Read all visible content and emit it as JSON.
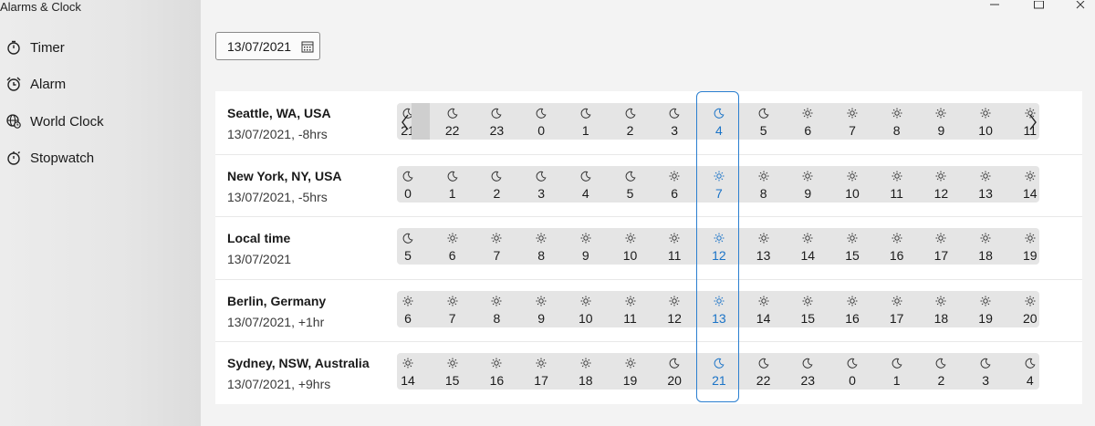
{
  "app": {
    "title": "Alarms & Clock"
  },
  "nav": [
    {
      "label": "Timer",
      "icon": "timer-icon"
    },
    {
      "label": "Alarm",
      "icon": "alarm-icon"
    },
    {
      "label": "World Clock",
      "icon": "globe-icon"
    },
    {
      "label": "Stopwatch",
      "icon": "stopwatch-icon"
    }
  ],
  "window": {
    "buttons": [
      "minimize-icon",
      "maximize-icon",
      "close-icon"
    ]
  },
  "date_picker": {
    "value": "13/07/2021",
    "icon": "calendar-icon"
  },
  "colors": {
    "accent": "#2b7fd0",
    "strip": "#e5e5e5",
    "card": "#ffffff"
  },
  "rows": [
    {
      "city": "Seattle, WA, USA",
      "sub": "13/07/2021, -8hrs",
      "scrollable": true,
      "hours": [
        {
          "h": "21",
          "icon": "moon"
        },
        {
          "h": "22",
          "icon": "moon"
        },
        {
          "h": "23",
          "icon": "moon"
        },
        {
          "h": "0",
          "icon": "moon"
        },
        {
          "h": "1",
          "icon": "moon"
        },
        {
          "h": "2",
          "icon": "moon"
        },
        {
          "h": "3",
          "icon": "moon"
        },
        {
          "h": "4",
          "icon": "moon",
          "current": true
        },
        {
          "h": "5",
          "icon": "moon"
        },
        {
          "h": "6",
          "icon": "sun"
        },
        {
          "h": "7",
          "icon": "sun"
        },
        {
          "h": "8",
          "icon": "sun"
        },
        {
          "h": "9",
          "icon": "sun"
        },
        {
          "h": "10",
          "icon": "sun"
        },
        {
          "h": "11",
          "icon": "sun"
        }
      ]
    },
    {
      "city": "New York, NY, USA",
      "sub": "13/07/2021, -5hrs",
      "hours": [
        {
          "h": "0",
          "icon": "moon"
        },
        {
          "h": "1",
          "icon": "moon"
        },
        {
          "h": "2",
          "icon": "moon"
        },
        {
          "h": "3",
          "icon": "moon"
        },
        {
          "h": "4",
          "icon": "moon"
        },
        {
          "h": "5",
          "icon": "moon"
        },
        {
          "h": "6",
          "icon": "sun"
        },
        {
          "h": "7",
          "icon": "sun",
          "current": true
        },
        {
          "h": "8",
          "icon": "sun"
        },
        {
          "h": "9",
          "icon": "sun"
        },
        {
          "h": "10",
          "icon": "sun"
        },
        {
          "h": "11",
          "icon": "sun"
        },
        {
          "h": "12",
          "icon": "sun"
        },
        {
          "h": "13",
          "icon": "sun"
        },
        {
          "h": "14",
          "icon": "sun"
        }
      ]
    },
    {
      "city": "Local time",
      "sub": "13/07/2021",
      "hours": [
        {
          "h": "5",
          "icon": "moon"
        },
        {
          "h": "6",
          "icon": "sun"
        },
        {
          "h": "7",
          "icon": "sun"
        },
        {
          "h": "8",
          "icon": "sun"
        },
        {
          "h": "9",
          "icon": "sun"
        },
        {
          "h": "10",
          "icon": "sun"
        },
        {
          "h": "11",
          "icon": "sun"
        },
        {
          "h": "12",
          "icon": "sun",
          "current": true
        },
        {
          "h": "13",
          "icon": "sun"
        },
        {
          "h": "14",
          "icon": "sun"
        },
        {
          "h": "15",
          "icon": "sun"
        },
        {
          "h": "16",
          "icon": "sun"
        },
        {
          "h": "17",
          "icon": "sun"
        },
        {
          "h": "18",
          "icon": "sun"
        },
        {
          "h": "19",
          "icon": "sun"
        }
      ]
    },
    {
      "city": "Berlin, Germany",
      "sub": "13/07/2021, +1hr",
      "hours": [
        {
          "h": "6",
          "icon": "sun"
        },
        {
          "h": "7",
          "icon": "sun"
        },
        {
          "h": "8",
          "icon": "sun"
        },
        {
          "h": "9",
          "icon": "sun"
        },
        {
          "h": "10",
          "icon": "sun"
        },
        {
          "h": "11",
          "icon": "sun"
        },
        {
          "h": "12",
          "icon": "sun"
        },
        {
          "h": "13",
          "icon": "sun",
          "current": true
        },
        {
          "h": "14",
          "icon": "sun"
        },
        {
          "h": "15",
          "icon": "sun"
        },
        {
          "h": "16",
          "icon": "sun"
        },
        {
          "h": "17",
          "icon": "sun"
        },
        {
          "h": "18",
          "icon": "sun"
        },
        {
          "h": "19",
          "icon": "sun"
        },
        {
          "h": "20",
          "icon": "sun"
        }
      ]
    },
    {
      "city": "Sydney, NSW, Australia",
      "sub": "13/07/2021, +9hrs",
      "hours": [
        {
          "h": "14",
          "icon": "sun"
        },
        {
          "h": "15",
          "icon": "sun"
        },
        {
          "h": "16",
          "icon": "sun"
        },
        {
          "h": "17",
          "icon": "sun"
        },
        {
          "h": "18",
          "icon": "sun"
        },
        {
          "h": "19",
          "icon": "sun"
        },
        {
          "h": "20",
          "icon": "moon"
        },
        {
          "h": "21",
          "icon": "moon",
          "current": true
        },
        {
          "h": "22",
          "icon": "moon"
        },
        {
          "h": "23",
          "icon": "moon"
        },
        {
          "h": "0",
          "icon": "moon"
        },
        {
          "h": "1",
          "icon": "moon"
        },
        {
          "h": "2",
          "icon": "moon"
        },
        {
          "h": "3",
          "icon": "moon"
        },
        {
          "h": "4",
          "icon": "moon"
        }
      ]
    }
  ]
}
